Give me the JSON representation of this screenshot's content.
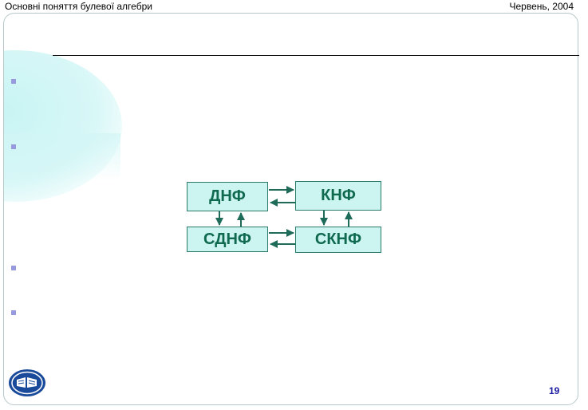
{
  "header": {
    "title": "Основні поняття булевої алгебри",
    "date": "Червень, 2004"
  },
  "diagram": {
    "boxes": {
      "dnf": "ДНФ",
      "knf": "КНФ",
      "sdnf": "СДНФ",
      "sknf": "СКНФ"
    }
  },
  "footer": {
    "page_number": "19"
  },
  "colors": {
    "box_fill": "#ccf4f1",
    "box_text": "#0f6a50",
    "arrow": "#1f6b5a",
    "bullet": "#9999dd",
    "page_number": "#1a1aa0",
    "logo": "#1a4a9a"
  },
  "icons": {
    "logo": "university-emblem-icon",
    "bullet": "square-bullet-icon"
  }
}
